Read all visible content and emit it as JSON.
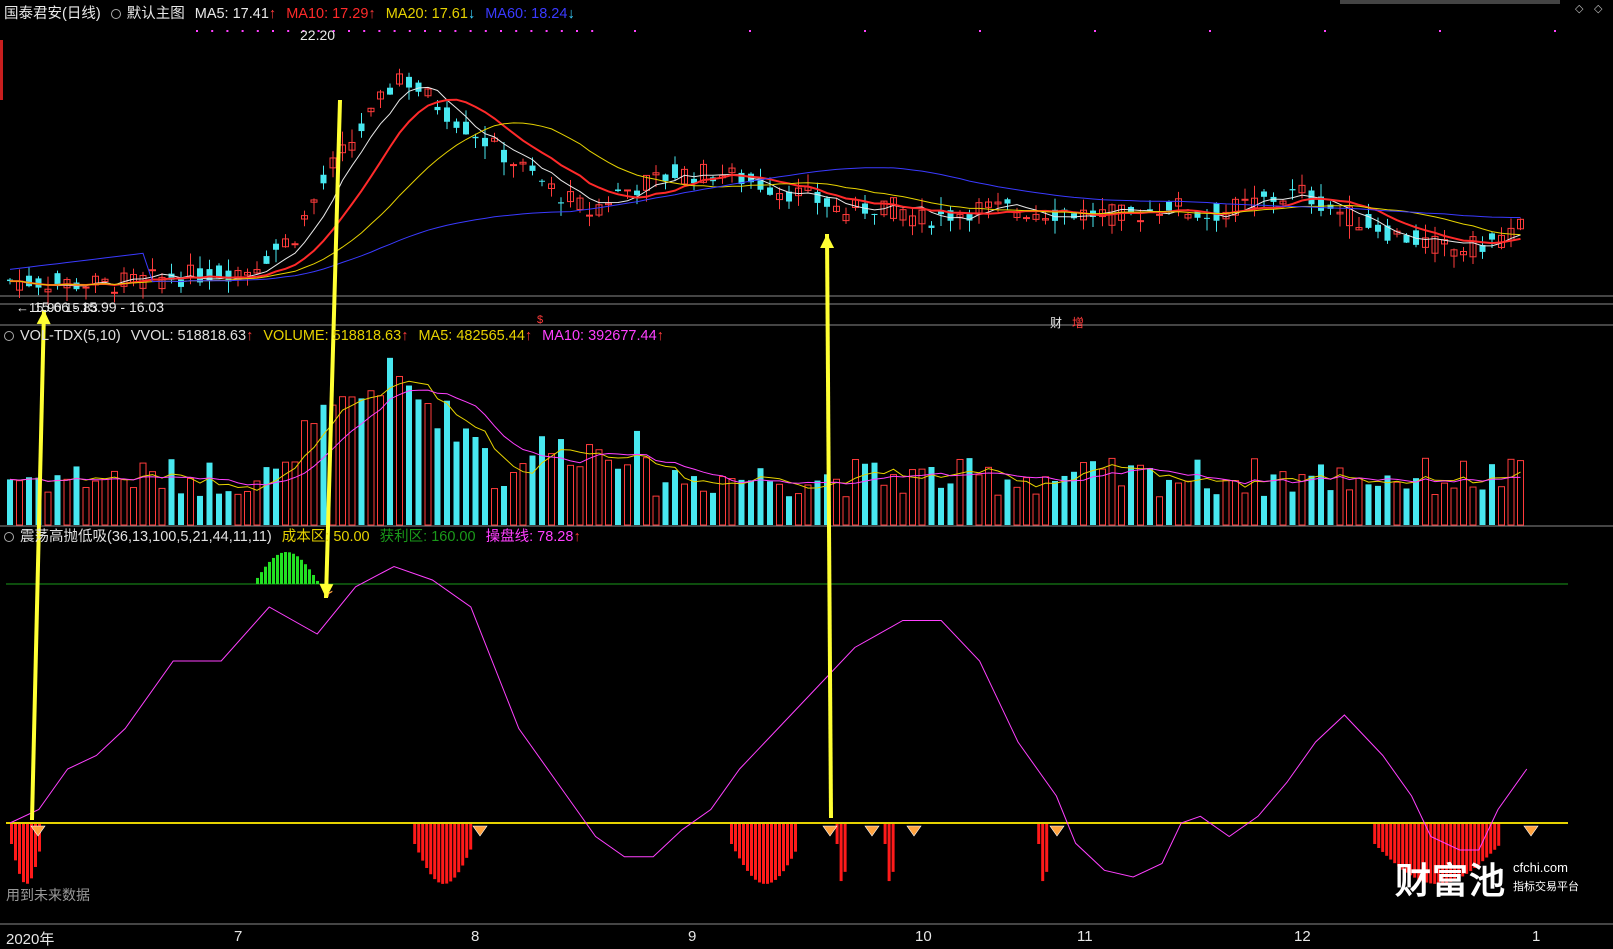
{
  "main_panel": {
    "stock_name": "国泰君安(日线)",
    "template": "默认主图",
    "ma5": {
      "label": "MA5: 17.41",
      "arrow": "↑",
      "color": "#e8e8e8"
    },
    "ma10": {
      "label": "MA10: 17.29",
      "arrow": "↑",
      "color": "#ff2a2a"
    },
    "ma20": {
      "label": "MA20: 17.61",
      "arrow": "↓",
      "color": "#e6d200"
    },
    "ma60": {
      "label": "MA60: 18.24",
      "arrow": "↓",
      "color": "#3a3aff"
    },
    "high_label": "22.20",
    "low_label": "15.66 - 15.99 - 16.03",
    "low_label_prefix": "←15.90  15.83",
    "event_marks": {
      "dollar": "$",
      "cai": "财",
      "zeng": "增"
    }
  },
  "volume_panel": {
    "title": "VOL-TDX(5,10)",
    "vvol": "VVOL: 518818.63",
    "volume": "VOLUME: 518818.63",
    "ma5": "MA5: 482565.44",
    "ma10": "MA10: 392677.44",
    "up_arrow": "↑",
    "colors": {
      "vvol": "#e0e0e0",
      "volume": "#e6d200",
      "ma5": "#e6d200",
      "ma10": "#ff40ff"
    }
  },
  "indicator_panel": {
    "title": "震荡高抛低吸(36,13,100,5,21,44,11,11)",
    "cost_zone": "成本区: 50.00",
    "profit_zone": "获利区: 160.00",
    "control_line": "操盘线: 78.28",
    "up_arrow": "↑",
    "colors": {
      "cost": "#e6d200",
      "profit": "#1a9a1a",
      "control": "#ff40ff"
    },
    "watermark": "用到未来数据"
  },
  "x_axis": {
    "ticks": [
      {
        "label": "2020年"
      },
      {
        "label": "7"
      },
      {
        "label": "8"
      },
      {
        "label": "9"
      },
      {
        "label": "10"
      },
      {
        "label": "11"
      },
      {
        "label": "12"
      },
      {
        "label": "1"
      }
    ]
  },
  "brand": {
    "name": "财富池",
    "site": "cfchi.com",
    "tagline": "指标交易平台"
  },
  "chart_data": {
    "type": "candlestick",
    "title": "国泰君安(日线)",
    "ma_colors": {
      "ma5": "#e8e8e8",
      "ma10": "#ff2a2a",
      "ma20": "#e6d200",
      "ma60": "#3a3aff"
    },
    "candle_colors": {
      "up": "#ff3b3b",
      "down": "#48e8f0"
    },
    "annotations": {
      "max": 22.2,
      "min": 15.66
    },
    "oscillator": {
      "levels": {
        "cost": 50.0,
        "profit": 160.0,
        "control": 78.28
      },
      "line_color": "#ff40ff"
    }
  }
}
